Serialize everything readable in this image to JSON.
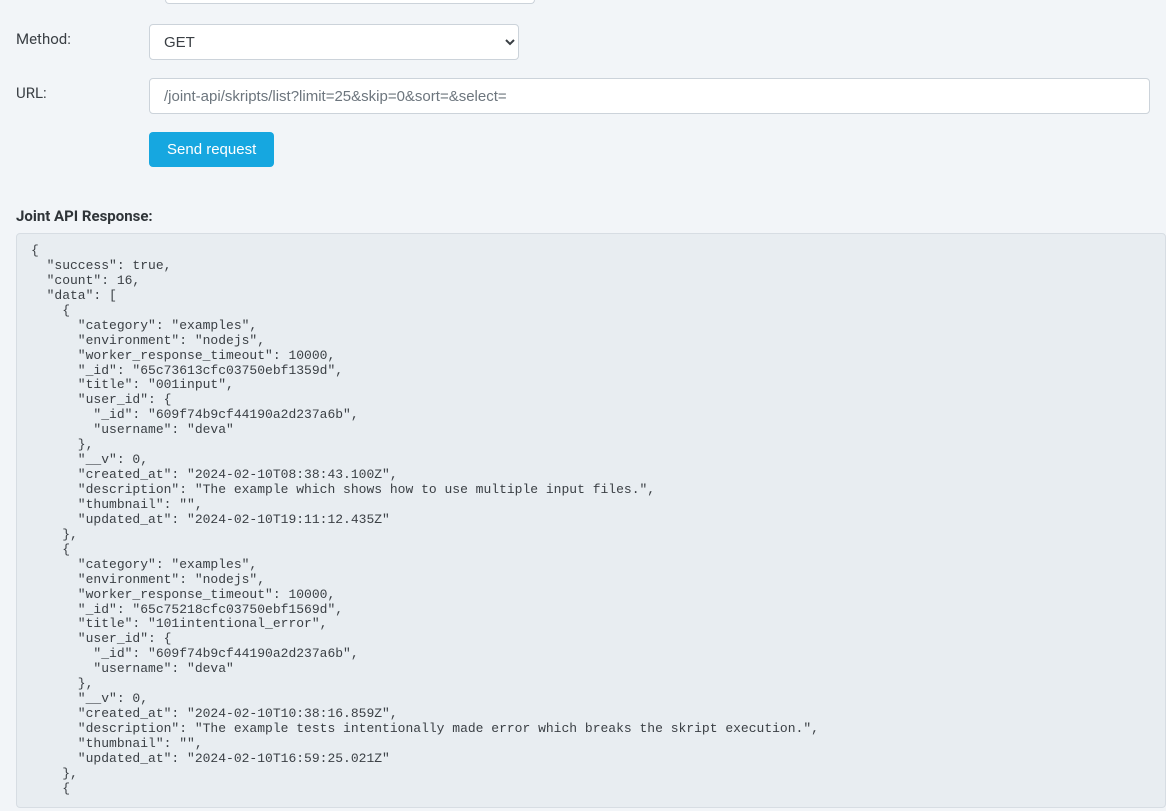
{
  "form": {
    "method_label": "Method:",
    "method_value": "GET",
    "url_label": "URL:",
    "url_value": "/joint-api/skripts/list?limit=25&skip=0&sort=&select=",
    "send_button": "Send request"
  },
  "response": {
    "heading": "Joint API Response:",
    "body": "{\n  \"success\": true,\n  \"count\": 16,\n  \"data\": [\n    {\n      \"category\": \"examples\",\n      \"environment\": \"nodejs\",\n      \"worker_response_timeout\": 10000,\n      \"_id\": \"65c73613cfc03750ebf1359d\",\n      \"title\": \"001input\",\n      \"user_id\": {\n        \"_id\": \"609f74b9cf44190a2d237a6b\",\n        \"username\": \"deva\"\n      },\n      \"__v\": 0,\n      \"created_at\": \"2024-02-10T08:38:43.100Z\",\n      \"description\": \"The example which shows how to use multiple input files.\",\n      \"thumbnail\": \"\",\n      \"updated_at\": \"2024-02-10T19:11:12.435Z\"\n    },\n    {\n      \"category\": \"examples\",\n      \"environment\": \"nodejs\",\n      \"worker_response_timeout\": 10000,\n      \"_id\": \"65c75218cfc03750ebf1569d\",\n      \"title\": \"101intentional_error\",\n      \"user_id\": {\n        \"_id\": \"609f74b9cf44190a2d237a6b\",\n        \"username\": \"deva\"\n      },\n      \"__v\": 0,\n      \"created_at\": \"2024-02-10T10:38:16.859Z\",\n      \"description\": \"The example tests intentionally made error which breaks the skript execution.\",\n      \"thumbnail\": \"\",\n      \"updated_at\": \"2024-02-10T16:59:25.021Z\"\n    },\n    {"
  }
}
